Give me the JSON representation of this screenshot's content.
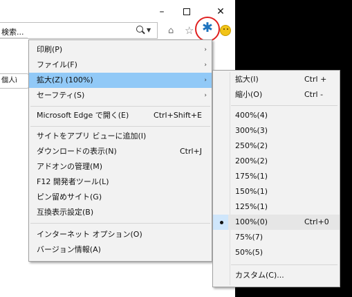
{
  "window": {
    "minimize_glyph": "–",
    "close_glyph": "✕"
  },
  "address": {
    "search_text": "検索...",
    "left_tab_text": "個人ì"
  },
  "toolbar": {
    "icons": [
      "search-icon",
      "home-icon",
      "star-icon",
      "gear-icon",
      "smiley-icon"
    ],
    "gear_color": "#1e73be",
    "highlight_ring_color": "#e02020"
  },
  "menu": {
    "items": [
      {
        "label": "印刷(P)",
        "submenu": true
      },
      {
        "label": "ファイル(F)",
        "submenu": true
      },
      {
        "label": "拡大(Z) (100%)",
        "submenu": true,
        "highlighted": true
      },
      {
        "label": "セーフティ(S)",
        "submenu": true
      },
      {
        "label": "Microsoft Edge で開く(E)",
        "shortcut": "Ctrl+Shift+E"
      },
      {
        "label": "サイトをアプリ ビューに追加(I)"
      },
      {
        "label": "ダウンロードの表示(N)",
        "shortcut": "Ctrl+J"
      },
      {
        "label": "アドオンの管理(M)"
      },
      {
        "label": "F12 開発者ツール(L)"
      },
      {
        "label": "ピン留めサイト(G)"
      },
      {
        "label": "互換表示設定(B)"
      },
      {
        "label": "インターネット オプション(O)"
      },
      {
        "label": "バージョン情報(A)"
      }
    ],
    "arrow": "›",
    "highlight_color": "#91c9f7"
  },
  "zoom_submenu": {
    "items": [
      {
        "label": "拡大(I)",
        "shortcut": "Ctrl +"
      },
      {
        "label": "縮小(O)",
        "shortcut": "Ctrl -"
      },
      {
        "label": "400%(4)"
      },
      {
        "label": "300%(3)"
      },
      {
        "label": "250%(2)"
      },
      {
        "label": "200%(2)"
      },
      {
        "label": "175%(1)"
      },
      {
        "label": "150%(1)"
      },
      {
        "label": "125%(1)"
      },
      {
        "label": "100%(0)",
        "shortcut": "Ctrl+0",
        "selected": true
      },
      {
        "label": "75%(7)"
      },
      {
        "label": "50%(5)"
      },
      {
        "label": "カスタム(C)..."
      }
    ]
  }
}
